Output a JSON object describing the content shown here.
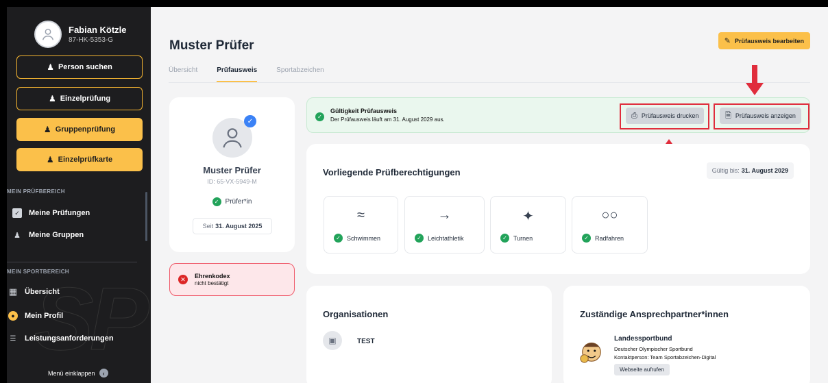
{
  "user": {
    "name": "Fabian Kötzle",
    "id": "87-HK-5353-G"
  },
  "sidebar": {
    "buttons": [
      {
        "label": "Person suchen",
        "icon": "users-search-icon"
      },
      {
        "label": "Einzelprüfung",
        "icon": "user-icon"
      },
      {
        "label": "Gruppenprüfung",
        "icon": "users-icon"
      },
      {
        "label": "Einzelprüfkarte",
        "icon": "user-card-icon"
      }
    ],
    "section1": "MEIN PRÜFBEREICH",
    "items1": [
      {
        "label": "Meine Prüfungen",
        "icon": "clipboard-check-icon"
      },
      {
        "label": "Meine Gruppen",
        "icon": "group-icon"
      }
    ],
    "section2": "MEIN SPORTBEREICH",
    "items2": [
      {
        "label": "Übersicht",
        "icon": "dashboard-icon"
      },
      {
        "label": "Mein Profil",
        "icon": "profile-icon"
      },
      {
        "label": "Leistungsanforderungen",
        "icon": "list-check-icon"
      }
    ],
    "collapse": "Menü einklappen"
  },
  "page": {
    "title": "Muster Prüfer",
    "edit_button": "Prüfausweis bearbeiten",
    "tabs": [
      "Übersicht",
      "Prüfausweis",
      "Sportabzeichen"
    ]
  },
  "profile": {
    "name": "Muster Prüfer",
    "id": "ID: 65-VX-5949-M",
    "role": "Prüfer*in",
    "since_prefix": "Seit",
    "since_date": "31. August 2025"
  },
  "ehrenkodex": {
    "title": "Ehrenkodex",
    "status": "nicht bestätigt"
  },
  "validity": {
    "title": "Gültigkeit Prüfausweis",
    "text": "Der Prüfausweis läuft am 31. August 2029 aus.",
    "print_button": "Prüfausweis drucken",
    "show_button": "Prüfausweis anzeigen"
  },
  "permissions": {
    "title": "Vorliegende Prüfberechtigungen",
    "valid_prefix": "Gültig bis:",
    "valid_date": "31. August 2029",
    "sports": [
      {
        "label": "Schwimmen",
        "icon": "swimming-icon"
      },
      {
        "label": "Leichtathletik",
        "icon": "running-icon"
      },
      {
        "label": "Turnen",
        "icon": "gymnastics-icon"
      },
      {
        "label": "Radfahren",
        "icon": "cycling-icon"
      }
    ]
  },
  "organisations": {
    "title": "Organisationen",
    "items": [
      "TEST"
    ]
  },
  "contacts": {
    "title": "Zuständige Ansprechpartner*innen",
    "org": "Landessportbund",
    "line1": "Deutscher Olympischer Sportbund",
    "line2": "Kontaktperson: Team Sportabzeichen-Digital",
    "button": "Webseite aufrufen"
  },
  "colors": {
    "accent": "#fbc04a",
    "sidebar": "#1d1d1f",
    "success": "#22a35a",
    "error": "#dc2626",
    "highlight": "#e02d3c"
  }
}
